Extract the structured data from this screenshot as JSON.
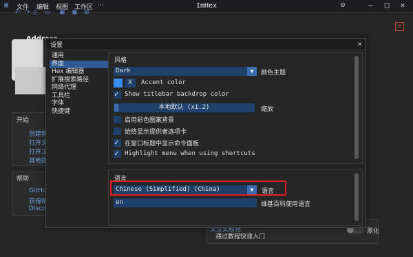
{
  "titlebar": {
    "menus": [
      "文件",
      "编辑",
      "视图",
      "工作区"
    ],
    "title": "ImHex",
    "accent_icon_color": "#5c7fbd"
  },
  "background": {
    "logo_text": "Address",
    "start_header": "开始",
    "start_items": [
      "创建新",
      "打开文",
      "打开工",
      "其他提"
    ],
    "help_header": "帮助",
    "help_items": [
      "GitHub",
      "获得帮",
      "Discor"
    ],
    "tutorial_link": "交互式教程",
    "tutorial_desc": "通过教程快速入门",
    "toggle_label": "黑化"
  },
  "dialog": {
    "title": "设置",
    "nav": [
      "通用",
      "界面",
      "Hex 编辑器",
      "扩展搜索路径",
      "网络代理",
      "工具栏",
      "字体",
      "快捷键"
    ],
    "active_nav_index": 1,
    "style_section": {
      "header": "风格",
      "theme_value": "Dark",
      "theme_label": "颜色主题",
      "accent_swatch_color": "#3a8ef0",
      "accent_x": "X",
      "accent_label": "Accent color",
      "titlebar_backdrop": {
        "label": "Show titlebar backdrop color",
        "checked": true
      },
      "scale_value": "本地默认 (x1.2)",
      "scale_label": "缩放",
      "colorful_bg": {
        "label": "启用彩色图案背景",
        "checked": false
      },
      "always_tabs": {
        "label": "始终显示提供者选项卡",
        "checked": false
      },
      "cmd_palette": {
        "label": "在窗口标题中显示命令面板",
        "checked": true
      },
      "highlight_menu": {
        "label": "Highlight menu when using shortcuts",
        "checked": true
      }
    },
    "language_section": {
      "header": "语言",
      "language_value": "Chinese (Simplified) (China)",
      "language_label": "语言",
      "wiki_value": "en",
      "wiki_label": "维基百科使用语言"
    }
  }
}
